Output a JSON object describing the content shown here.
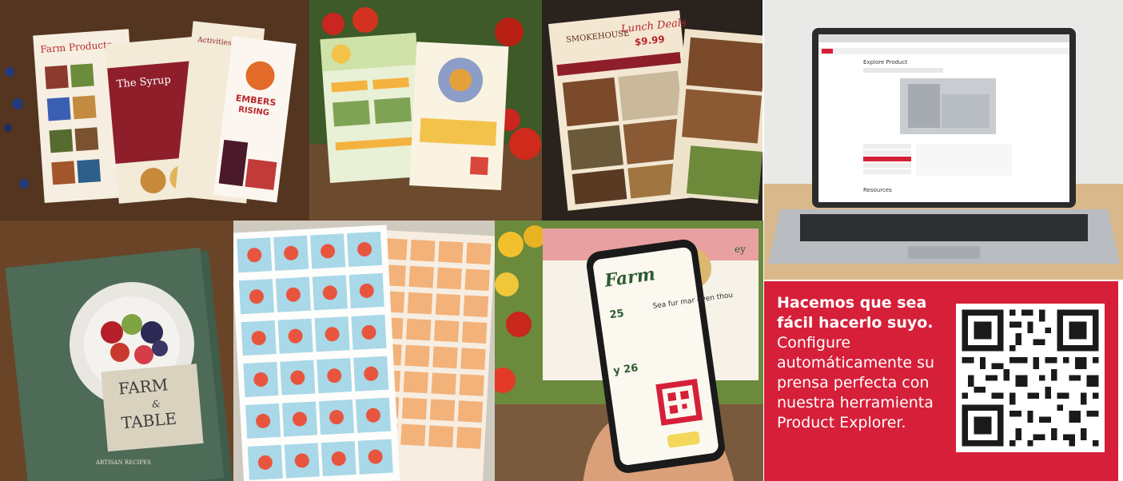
{
  "colors": {
    "brand_red": "#d61f39",
    "wood_dark": "#4a2f1d",
    "white": "#ffffff"
  },
  "tiles": {
    "flyer_farm_products": {
      "heading": "Farm Products",
      "panel_title": "The Syrup",
      "right_heading": "Activities & Offerings",
      "logo_line1": "EMBERS",
      "logo_line2": "RISING"
    },
    "market_flyers": {
      "subject": "market-flyers-on-produce-table"
    },
    "restaurant_menu": {
      "brand": "SMOKEHOUSE",
      "special": "Lunch Deals",
      "price": "$9.99"
    },
    "laptop": {
      "page_title": "Explore Product",
      "section_title": "Resources"
    },
    "cookbook": {
      "title_line1": "FARM",
      "amp": "&",
      "title_line2": "TABLE",
      "subtitle": "ARTISAN RECIPES"
    },
    "label_sheets": {
      "subject": "printed-label-sheets"
    },
    "phone_poster": {
      "poster_title": "Farm",
      "poster_sub": "ey",
      "date_1": "25",
      "date_2": "y 26",
      "side_text": "Sea fur mar even thou"
    }
  },
  "promo": {
    "headline": "Hacemos que sea fácil hacerlo suyo.",
    "body": "Configure automáticamente su prensa perfecta con nuestra herramienta Product Explorer."
  },
  "qr": {
    "icon": "qr-code-icon"
  }
}
